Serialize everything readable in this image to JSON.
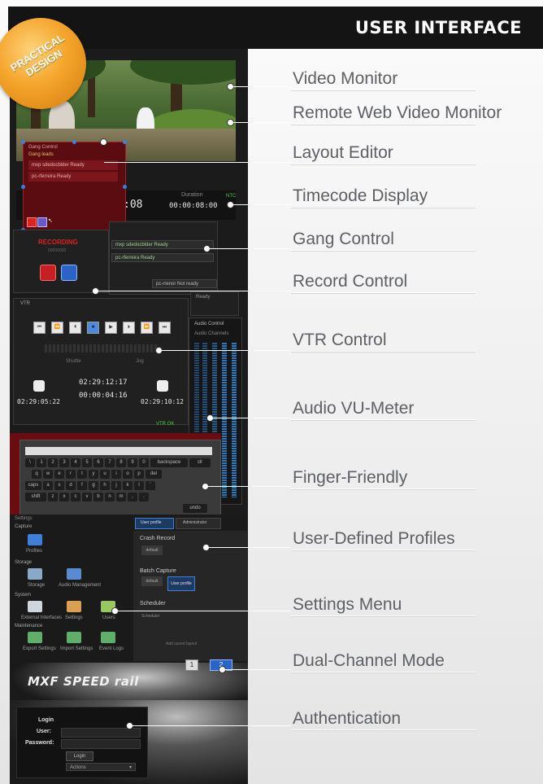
{
  "header": {
    "title": "USER INTERFACE"
  },
  "badge": {
    "line1": "PRACTICAL",
    "line2": "DESIGN"
  },
  "features": [
    "Video Monitor",
    "Remote Web Video Monitor",
    "Layout Editor",
    "Timecode Display",
    "Gang Control",
    "Record Control",
    "VTR Control",
    "Audio VU-Meter",
    "Finger-Friendly",
    "User-Defined Profiles",
    "Settings Menu",
    "Dual-Channel Mode",
    "Authentication"
  ],
  "screens": {
    "timecode": {
      "value": "00:00:08:00",
      "label": "Duration",
      "left": ":08",
      "ntsc": "NTC"
    },
    "layout_editor": {
      "title": "Gang Control",
      "subtitle": "Gang leads",
      "rows": [
        "mxp sdedocblder  Ready",
        "pc-rferreira  Ready"
      ]
    },
    "record": {
      "label": "RECORDING",
      "sub": "00000000"
    },
    "gang": {
      "rows": [
        "mxp sdedocblder  Ready",
        "pc-rferreira  Ready",
        "pc-rrenor  Not ready"
      ],
      "status": "Ready"
    },
    "vtr": {
      "label": "VTR",
      "shuttle": "Shuttle",
      "jog": "Jog",
      "tc_main": "02:29:12:17",
      "tc_sub": "00:00:04:16",
      "tc_left": "02:29:05:22",
      "tc_right": "02:29:10:12",
      "status": "VTR OK"
    },
    "audio": {
      "title": "Audio Control",
      "channels": "Audio Channels"
    },
    "keyboard": {
      "rows": [
        [
          "\\",
          "1",
          "2",
          "3",
          "4",
          "5",
          "6",
          "7",
          "8",
          "9",
          "0",
          "backspace",
          "clr"
        ],
        [
          "q",
          "w",
          "e",
          "r",
          "t",
          "y",
          "u",
          "i",
          "o",
          "p",
          "del"
        ],
        [
          "caps",
          "a",
          "s",
          "d",
          "f",
          "g",
          "h",
          "j",
          "k",
          "l",
          "'"
        ],
        [
          "shift",
          "z",
          "x",
          "c",
          "v",
          "b",
          "n",
          "m",
          ",",
          "."
        ],
        [
          "undo"
        ]
      ]
    },
    "settings": {
      "title": "Settings",
      "sections": [
        "Capture",
        "Storage",
        "System",
        "Maintenance"
      ],
      "items": [
        "Profiles",
        "Storage",
        "Audio Management",
        "External Interfaces",
        "Settings",
        "Users",
        "Export Settings",
        "Import Settings",
        "Event Logs"
      ],
      "tabs": [
        "User profile",
        "Administrator"
      ],
      "profile_groups": [
        "Crash Record",
        "Batch Capture",
        "Scheduler"
      ],
      "profile_buttons": [
        "default",
        "default",
        "User profile"
      ],
      "scheduler_value": "Scheduler",
      "footer": "Add saved layout"
    },
    "dual": {
      "channel1": "1",
      "channel2": "2",
      "logo": "MXF SPEED rail"
    },
    "login": {
      "title": "Login",
      "user": "User:",
      "password": "Password:",
      "button": "Login",
      "actions": "Actions"
    }
  },
  "colors": {
    "accent": "#f4a52a",
    "header": "#141414",
    "label": "#5f6065",
    "record": "#c81f25",
    "stop": "#2b64c8"
  }
}
